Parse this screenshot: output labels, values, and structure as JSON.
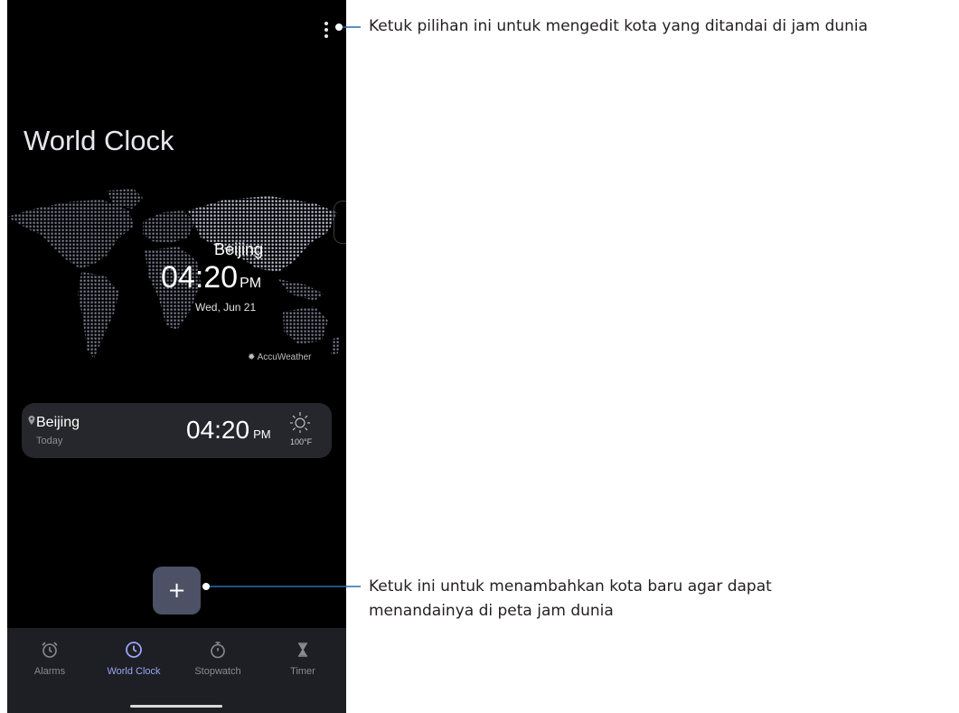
{
  "header": {
    "title": "World Clock",
    "menu_icon": "more-vert-icon"
  },
  "map": {
    "city": "Beijing",
    "time": "04:20",
    "ampm": "PM",
    "date": "Wed, Jun 21",
    "provider": "AccuWeather"
  },
  "city_card": {
    "city": "Beijing",
    "day": "Today",
    "time": "04:20",
    "ampm": "PM",
    "weather_icon": "sun-icon",
    "temperature": "100°F"
  },
  "fab": {
    "label": "+",
    "icon": "plus-icon"
  },
  "nav": {
    "items": [
      {
        "label": "Alarms",
        "icon": "alarm-icon",
        "active": false
      },
      {
        "label": "World Clock",
        "icon": "clock-icon",
        "active": true
      },
      {
        "label": "Stopwatch",
        "icon": "stopwatch-icon",
        "active": false
      },
      {
        "label": "Timer",
        "icon": "hourglass-icon",
        "active": false
      }
    ]
  },
  "callouts": {
    "menu": "Ketuk pilihan ini untuk mengedit kota yang ditandai di jam dunia",
    "add_line1": "Ketuk ini untuk menambahkan kota baru agar dapat",
    "add_line2": "menandainya di peta jam dunia"
  },
  "colors": {
    "background": "#000000",
    "card": "#26272c",
    "fab": "#4d5166",
    "accent": "#9aa4f5",
    "navbar": "#1e1f24",
    "callout_line": "#2b6cb0"
  }
}
